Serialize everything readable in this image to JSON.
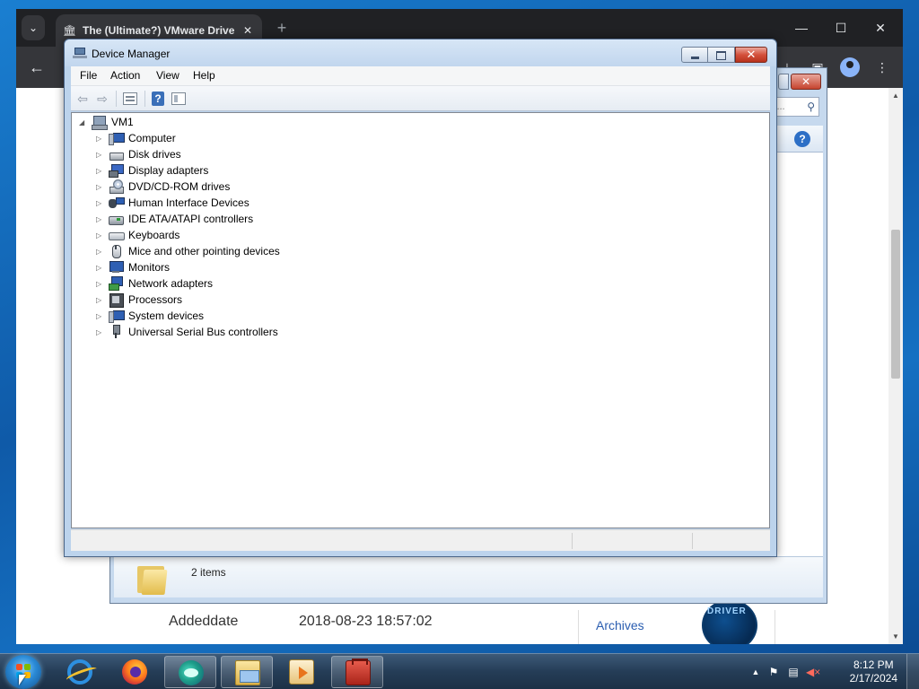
{
  "browser": {
    "tab_title": "The (Ultimate?) VMware Drive",
    "tab_close": "✕",
    "new_tab": "+",
    "window_min": "—",
    "window_max": "☐",
    "window_close": "✕",
    "back": "←"
  },
  "page": {
    "row_label": "Addeddate",
    "row_value": "2018-08-23 18:57:02",
    "sidebar_link": "Archives",
    "badge_text": "DRIVER"
  },
  "explorer": {
    "search_placeholder": "D...",
    "items_count": "2 items",
    "help_icon": "?"
  },
  "device_manager": {
    "title": "Device Manager",
    "menu": [
      "File",
      "Action",
      "View",
      "Help"
    ],
    "root": "VM1",
    "categories": [
      {
        "label": "Computer",
        "icon": "computer-icon"
      },
      {
        "label": "Disk drives",
        "icon": "disk-drive-icon"
      },
      {
        "label": "Display adapters",
        "icon": "display-adapter-icon"
      },
      {
        "label": "DVD/CD-ROM drives",
        "icon": "dvd-drive-icon"
      },
      {
        "label": "Human Interface Devices",
        "icon": "hid-icon"
      },
      {
        "label": "IDE ATA/ATAPI controllers",
        "icon": "ide-controller-icon"
      },
      {
        "label": "Keyboards",
        "icon": "keyboard-icon"
      },
      {
        "label": "Mice and other pointing devices",
        "icon": "mouse-icon"
      },
      {
        "label": "Monitors",
        "icon": "monitor-icon"
      },
      {
        "label": "Network adapters",
        "icon": "network-adapter-icon"
      },
      {
        "label": "Processors",
        "icon": "processor-icon"
      },
      {
        "label": "System devices",
        "icon": "system-devices-icon"
      },
      {
        "label": "Universal Serial Bus controllers",
        "icon": "usb-icon"
      }
    ]
  },
  "taskbar": {
    "time": "8:12 PM",
    "date": "2/17/2024",
    "apps": [
      "internet-explorer-icon",
      "firefox-icon",
      "edge-icon",
      "file-explorer-icon",
      "media-player-icon",
      "toolbox-icon"
    ]
  }
}
